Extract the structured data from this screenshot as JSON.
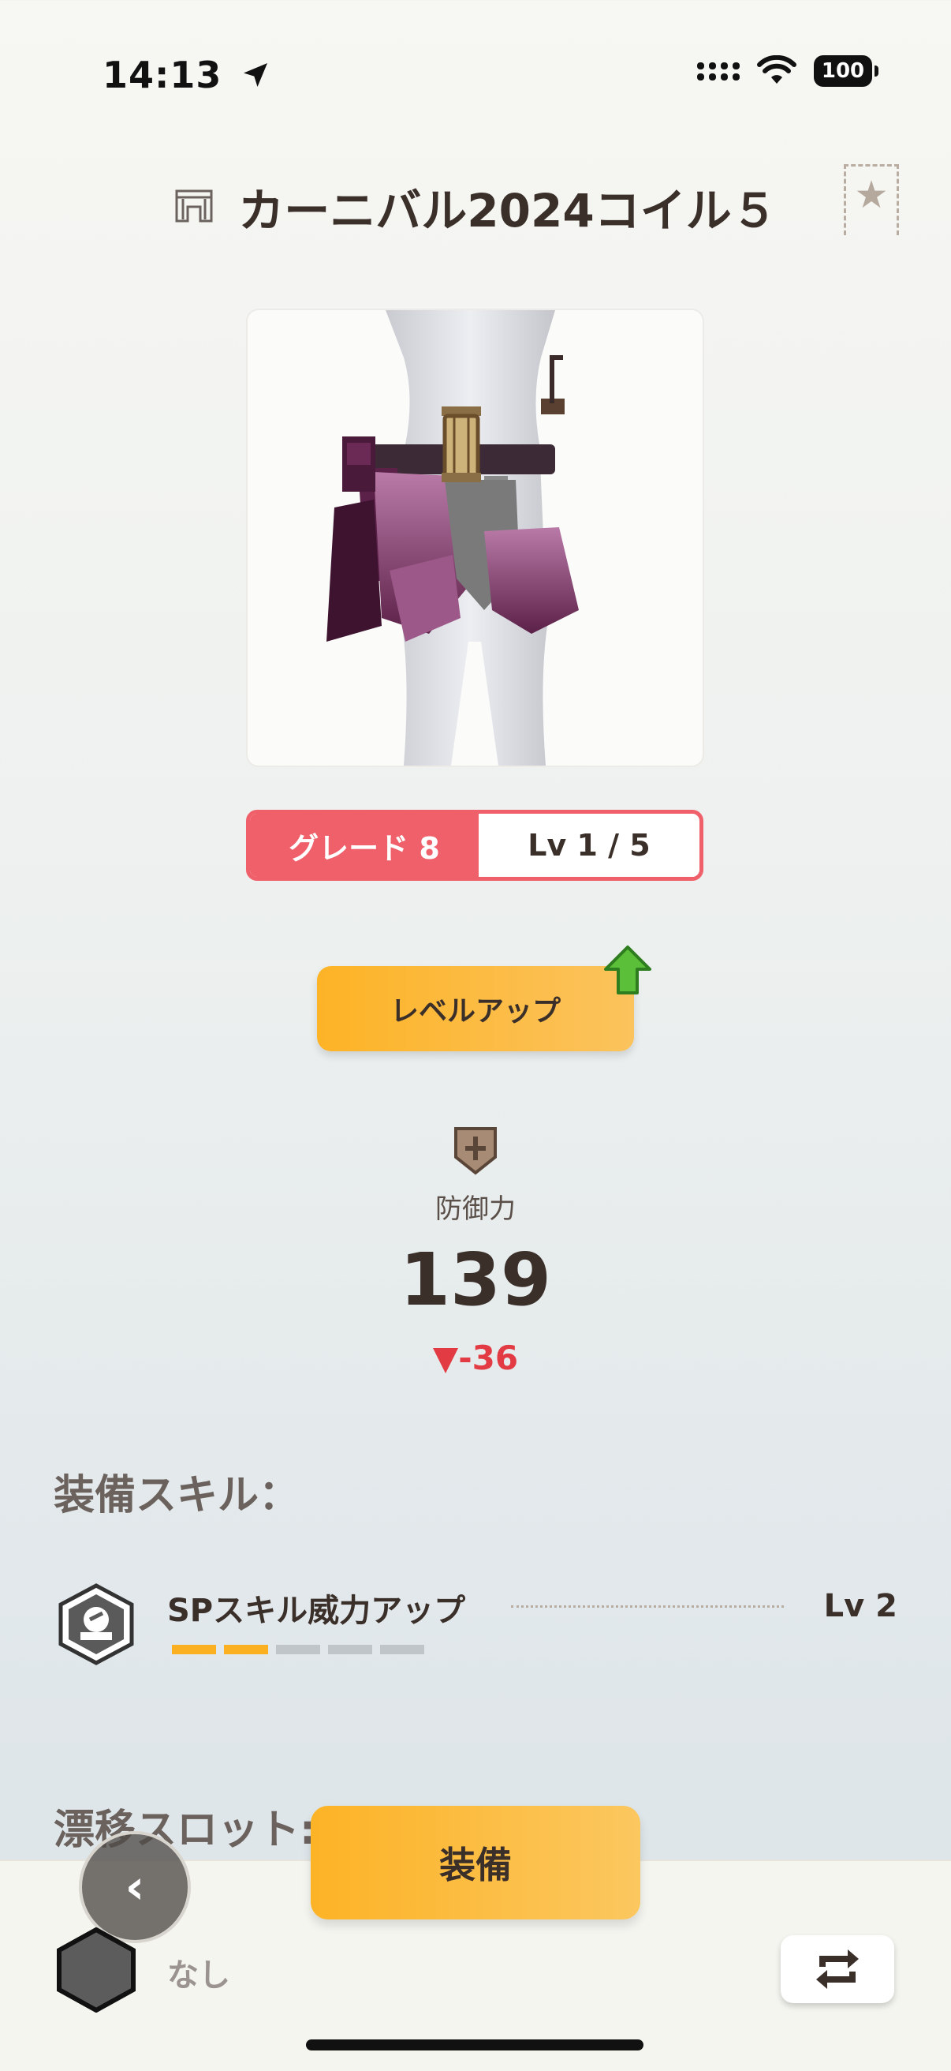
{
  "status_bar": {
    "time": "14:13",
    "battery": "100"
  },
  "header": {
    "title": "カーニバル2024コイル５",
    "category_icon": "waist-armor-icon",
    "favorite_icon": "star-icon"
  },
  "item": {
    "grade_label": "グレード 8",
    "level_label": "Lv 1 / 5"
  },
  "actions": {
    "level_up_label": "レベルアップ",
    "equip_label": "装備"
  },
  "defense": {
    "label": "防御力",
    "value": "139",
    "delta": "▼-36"
  },
  "skills": {
    "heading": "装備スキル：",
    "items": [
      {
        "name": "SPスキル威力アップ",
        "level": "Lv 2",
        "filled": 2,
        "total": 5
      }
    ]
  },
  "drift_slot": {
    "heading": "漂移スロット:",
    "value": "なし"
  },
  "colors": {
    "accent_orange": "#fdb326",
    "grade_red": "#f0606a",
    "negative_red": "#e23b43",
    "text_brown": "#3b2f2a"
  }
}
